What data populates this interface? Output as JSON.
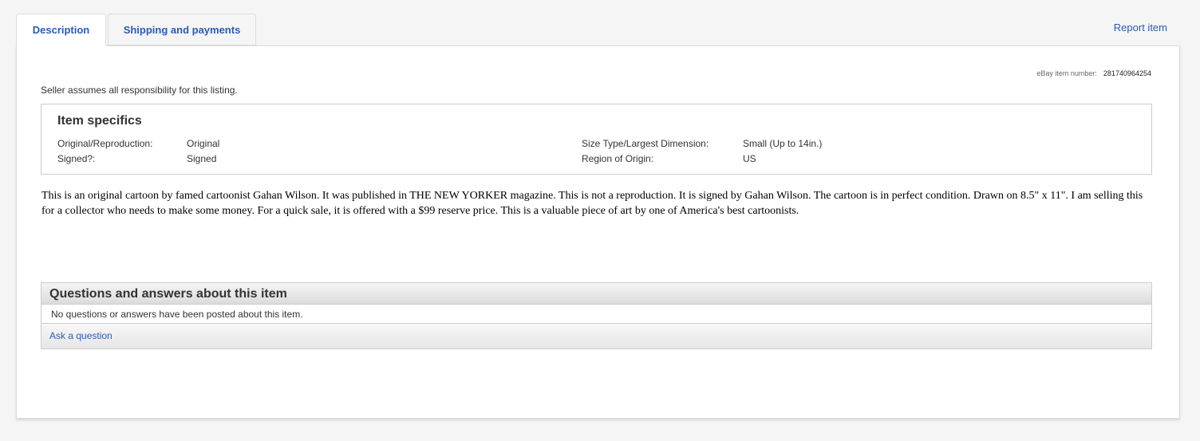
{
  "tabs": [
    {
      "label": "Description"
    },
    {
      "label": "Shipping and payments"
    }
  ],
  "report_link": "Report item",
  "item_number": {
    "label": "eBay item number:",
    "value": "281740964254"
  },
  "seller_note": "Seller assumes all responsibility for this listing.",
  "item_specifics": {
    "title": "Item specifics",
    "rows": [
      {
        "left_label": "Original/Reproduction:",
        "left_value": "Original",
        "right_label": "Size Type/Largest Dimension:",
        "right_value": "Small (Up to 14in.)"
      },
      {
        "left_label": "Signed?:",
        "left_value": "Signed",
        "right_label": "Region of Origin:",
        "right_value": "US"
      }
    ]
  },
  "description": "This is an original cartoon by famed cartoonist Gahan Wilson. It was published in THE NEW YORKER magazine. This is not a reproduction. It is signed by Gahan Wilson. The cartoon is in perfect condition. Drawn on 8.5\" x 11\". I am selling this for a collector who needs to make some money. For a quick sale, it is offered with a $99 reserve price. This is a valuable piece of art by one of America's best cartoonists.",
  "qa": {
    "title": "Questions and answers about this item",
    "empty_message": "No questions or answers have been posted about this item.",
    "ask_link": "Ask a question"
  }
}
